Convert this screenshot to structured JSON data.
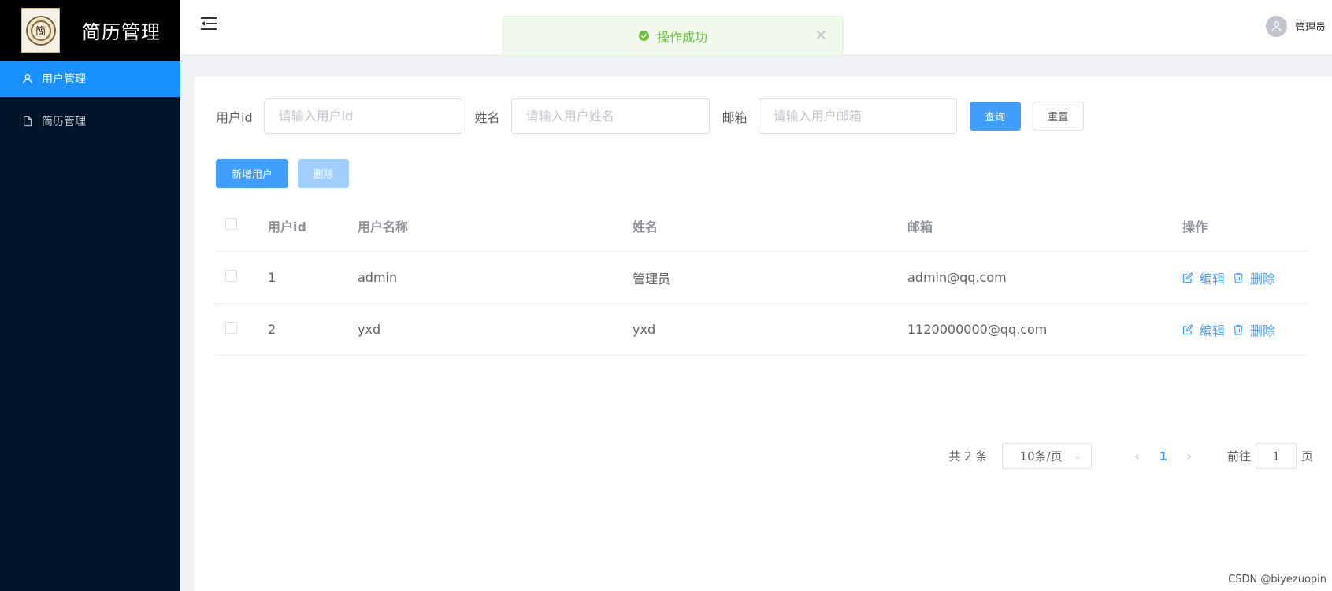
{
  "sidebar": {
    "title": "简历管理",
    "logo_text": "簡",
    "items": [
      {
        "label": "用户管理",
        "icon": "user-icon",
        "active": true
      },
      {
        "label": "简历管理",
        "icon": "document-icon",
        "active": false
      }
    ]
  },
  "header": {
    "user_name": "管理员"
  },
  "toast": {
    "message": "操作成功"
  },
  "search": {
    "fields": [
      {
        "label": "用户id",
        "placeholder": "请输入用户id"
      },
      {
        "label": "姓名",
        "placeholder": "请输入用户姓名"
      },
      {
        "label": "邮箱",
        "placeholder": "请输入用户邮箱"
      }
    ],
    "query_label": "查询",
    "reset_label": "重置"
  },
  "actions": {
    "add_label": "新增用户",
    "delete_label": "删除"
  },
  "table": {
    "columns": [
      "用户id",
      "用户名称",
      "姓名",
      "邮箱",
      "操作"
    ],
    "rows": [
      {
        "id": "1",
        "username": "admin",
        "name": "管理员",
        "email": "admin@qq.com"
      },
      {
        "id": "2",
        "username": "yxd",
        "name": "yxd",
        "email": "1120000000@qq.com"
      }
    ],
    "edit_label": "编辑",
    "delete_label": "删除"
  },
  "pagination": {
    "total_text": "共 2 条",
    "page_size": "10条/页",
    "current_page": "1",
    "goto_prefix": "前往",
    "goto_value": "1",
    "goto_suffix": "页"
  },
  "watermark": "CSDN @biyezuopin",
  "colors": {
    "primary": "#409eff",
    "sidebar": "#001529",
    "active_menu": "#1890ff",
    "success": "#67c23a"
  }
}
